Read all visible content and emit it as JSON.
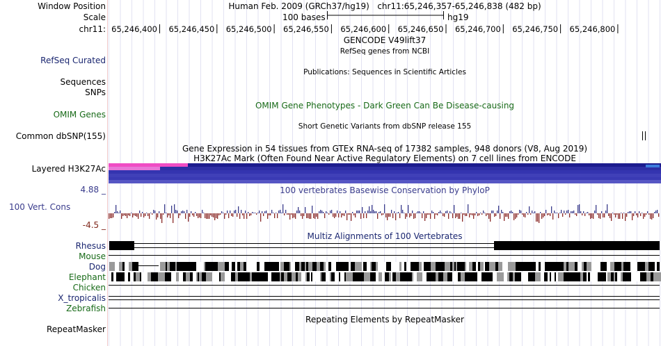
{
  "header": {
    "window_position_label": "Window Position",
    "scale_label": "Scale",
    "chrom_label": "chr11:",
    "assembly": "Human Feb. 2009 (GRCh37/hg19)",
    "position": "chr11:65,246,357-65,246,838 (482 bp)",
    "scale_text": "100 bases",
    "db": "hg19"
  },
  "ruler": {
    "ticks": [
      "65,246,400",
      "65,246,450",
      "65,246,500",
      "65,246,550",
      "65,246,600",
      "65,246,650",
      "65,246,700",
      "65,246,750",
      "65,246,800"
    ]
  },
  "tracks": {
    "gencode_title": "GENCODE V49lift37",
    "refseq_sub": "RefSeq genes from NCBI",
    "refseq_label": "RefSeq Curated",
    "publications": "Publications: Sequences in Scientific Articles",
    "sequences_label": "Sequences",
    "snps_label": "SNPs",
    "omim_label": "OMIM Genes",
    "omim_title": "OMIM Gene Phenotypes - Dark Green Can Be Disease-causing",
    "dbsnp_sub": "Short Genetic Variants from dbSNP release 155",
    "dbsnp_label": "Common dbSNP(155)",
    "gtex_title": "Gene Expression in 54 tissues from GTEx RNA-seq of 17382 samples, 948 donors (V8, Aug 2019)",
    "h3k_title": "H3K27Ac Mark (Often Found Near Active Regulatory Elements) on 7 cell lines from ENCODE",
    "h3k_label": "Layered H3K27Ac",
    "phylop_max": "4.88 _",
    "phylop_title": "100 vertebrates Basewise Conservation by PhyloP",
    "cons_label": "100 Vert. Cons",
    "phylop_min": "-4.5 _",
    "multiz_title": "Multiz Alignments of 100 Vertebrates",
    "species": [
      "Rhesus",
      "Mouse",
      "Dog",
      "Elephant",
      "Chicken",
      "X_tropicalis",
      "Zebrafish"
    ],
    "repeat_title": "Repeating Elements by RepeatMasker",
    "repeat_label": "RepeatMasker"
  },
  "colors": {
    "navy": "#1a2670",
    "green": "#186a18",
    "h3k_blue": "#2a2a9a",
    "h3k_pink": "#f04cc4",
    "phylop_pos": "#3a3c8c",
    "phylop_neg": "#8a2a28"
  }
}
